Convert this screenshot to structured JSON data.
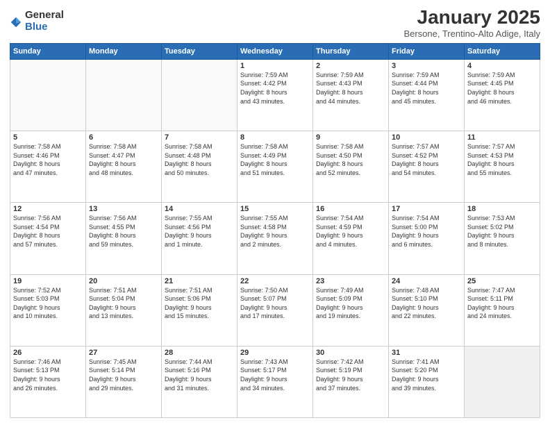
{
  "logo": {
    "general": "General",
    "blue": "Blue"
  },
  "header": {
    "title": "January 2025",
    "location": "Bersone, Trentino-Alto Adige, Italy"
  },
  "weekdays": [
    "Sunday",
    "Monday",
    "Tuesday",
    "Wednesday",
    "Thursday",
    "Friday",
    "Saturday"
  ],
  "weeks": [
    [
      {
        "day": "",
        "info": ""
      },
      {
        "day": "",
        "info": ""
      },
      {
        "day": "",
        "info": ""
      },
      {
        "day": "1",
        "info": "Sunrise: 7:59 AM\nSunset: 4:42 PM\nDaylight: 8 hours\nand 43 minutes."
      },
      {
        "day": "2",
        "info": "Sunrise: 7:59 AM\nSunset: 4:43 PM\nDaylight: 8 hours\nand 44 minutes."
      },
      {
        "day": "3",
        "info": "Sunrise: 7:59 AM\nSunset: 4:44 PM\nDaylight: 8 hours\nand 45 minutes."
      },
      {
        "day": "4",
        "info": "Sunrise: 7:59 AM\nSunset: 4:45 PM\nDaylight: 8 hours\nand 46 minutes."
      }
    ],
    [
      {
        "day": "5",
        "info": "Sunrise: 7:58 AM\nSunset: 4:46 PM\nDaylight: 8 hours\nand 47 minutes."
      },
      {
        "day": "6",
        "info": "Sunrise: 7:58 AM\nSunset: 4:47 PM\nDaylight: 8 hours\nand 48 minutes."
      },
      {
        "day": "7",
        "info": "Sunrise: 7:58 AM\nSunset: 4:48 PM\nDaylight: 8 hours\nand 50 minutes."
      },
      {
        "day": "8",
        "info": "Sunrise: 7:58 AM\nSunset: 4:49 PM\nDaylight: 8 hours\nand 51 minutes."
      },
      {
        "day": "9",
        "info": "Sunrise: 7:58 AM\nSunset: 4:50 PM\nDaylight: 8 hours\nand 52 minutes."
      },
      {
        "day": "10",
        "info": "Sunrise: 7:57 AM\nSunset: 4:52 PM\nDaylight: 8 hours\nand 54 minutes."
      },
      {
        "day": "11",
        "info": "Sunrise: 7:57 AM\nSunset: 4:53 PM\nDaylight: 8 hours\nand 55 minutes."
      }
    ],
    [
      {
        "day": "12",
        "info": "Sunrise: 7:56 AM\nSunset: 4:54 PM\nDaylight: 8 hours\nand 57 minutes."
      },
      {
        "day": "13",
        "info": "Sunrise: 7:56 AM\nSunset: 4:55 PM\nDaylight: 8 hours\nand 59 minutes."
      },
      {
        "day": "14",
        "info": "Sunrise: 7:55 AM\nSunset: 4:56 PM\nDaylight: 9 hours\nand 1 minute."
      },
      {
        "day": "15",
        "info": "Sunrise: 7:55 AM\nSunset: 4:58 PM\nDaylight: 9 hours\nand 2 minutes."
      },
      {
        "day": "16",
        "info": "Sunrise: 7:54 AM\nSunset: 4:59 PM\nDaylight: 9 hours\nand 4 minutes."
      },
      {
        "day": "17",
        "info": "Sunrise: 7:54 AM\nSunset: 5:00 PM\nDaylight: 9 hours\nand 6 minutes."
      },
      {
        "day": "18",
        "info": "Sunrise: 7:53 AM\nSunset: 5:02 PM\nDaylight: 9 hours\nand 8 minutes."
      }
    ],
    [
      {
        "day": "19",
        "info": "Sunrise: 7:52 AM\nSunset: 5:03 PM\nDaylight: 9 hours\nand 10 minutes."
      },
      {
        "day": "20",
        "info": "Sunrise: 7:51 AM\nSunset: 5:04 PM\nDaylight: 9 hours\nand 13 minutes."
      },
      {
        "day": "21",
        "info": "Sunrise: 7:51 AM\nSunset: 5:06 PM\nDaylight: 9 hours\nand 15 minutes."
      },
      {
        "day": "22",
        "info": "Sunrise: 7:50 AM\nSunset: 5:07 PM\nDaylight: 9 hours\nand 17 minutes."
      },
      {
        "day": "23",
        "info": "Sunrise: 7:49 AM\nSunset: 5:09 PM\nDaylight: 9 hours\nand 19 minutes."
      },
      {
        "day": "24",
        "info": "Sunrise: 7:48 AM\nSunset: 5:10 PM\nDaylight: 9 hours\nand 22 minutes."
      },
      {
        "day": "25",
        "info": "Sunrise: 7:47 AM\nSunset: 5:11 PM\nDaylight: 9 hours\nand 24 minutes."
      }
    ],
    [
      {
        "day": "26",
        "info": "Sunrise: 7:46 AM\nSunset: 5:13 PM\nDaylight: 9 hours\nand 26 minutes."
      },
      {
        "day": "27",
        "info": "Sunrise: 7:45 AM\nSunset: 5:14 PM\nDaylight: 9 hours\nand 29 minutes."
      },
      {
        "day": "28",
        "info": "Sunrise: 7:44 AM\nSunset: 5:16 PM\nDaylight: 9 hours\nand 31 minutes."
      },
      {
        "day": "29",
        "info": "Sunrise: 7:43 AM\nSunset: 5:17 PM\nDaylight: 9 hours\nand 34 minutes."
      },
      {
        "day": "30",
        "info": "Sunrise: 7:42 AM\nSunset: 5:19 PM\nDaylight: 9 hours\nand 37 minutes."
      },
      {
        "day": "31",
        "info": "Sunrise: 7:41 AM\nSunset: 5:20 PM\nDaylight: 9 hours\nand 39 minutes."
      },
      {
        "day": "",
        "info": ""
      }
    ]
  ]
}
